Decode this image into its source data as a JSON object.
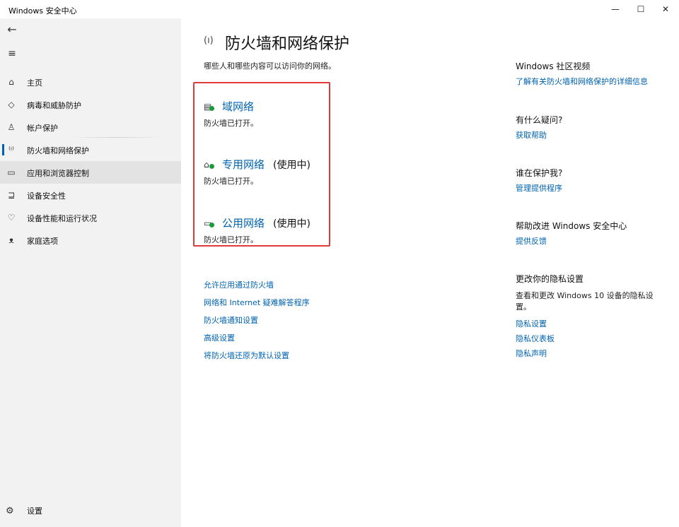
{
  "window": {
    "title": "Windows 安全中心",
    "minimize": "—",
    "maximize": "☐",
    "close": "✕"
  },
  "sidebar": {
    "back": "←",
    "menu": "≡",
    "items": [
      {
        "label": "主页",
        "icon": "home-icon"
      },
      {
        "label": "病毒和威胁防护",
        "icon": "shield-icon"
      },
      {
        "label": "帐户保护",
        "icon": "person-icon"
      },
      {
        "label": "防火墙和网络保护",
        "icon": "wifi-antenna-icon"
      },
      {
        "label": "应用和浏览器控制",
        "icon": "app-window-icon"
      },
      {
        "label": "设备安全性",
        "icon": "laptop-icon"
      },
      {
        "label": "设备性能和运行状况",
        "icon": "heart-icon"
      },
      {
        "label": "家庭选项",
        "icon": "family-icon"
      }
    ],
    "settings_label": "设置"
  },
  "main": {
    "header_icon": "(ı)",
    "title": "防火墙和网络保护",
    "subtitle": "哪些人和哪些内容可以访问你的网络。",
    "networks": [
      {
        "name": "域网络",
        "tag": "",
        "status": "防火墙已打开。"
      },
      {
        "name": "专用网络",
        "tag": "(使用中)",
        "status": "防火墙已打开。"
      },
      {
        "name": "公用网络",
        "tag": "(使用中)",
        "status": "防火墙已打开。"
      }
    ],
    "links": [
      "允许应用通过防火墙",
      "网络和 Internet 疑难解答程序",
      "防火墙通知设置",
      "高级设置",
      "将防火墙还原为默认设置"
    ]
  },
  "right": {
    "community_title": "Windows 社区视频",
    "community_link": "了解有关防火墙和网络保护的详细信息",
    "question_title": "有什么疑问?",
    "question_link": "获取帮助",
    "protect_title": "谁在保护我?",
    "protect_link": "管理提供程序",
    "improve_title": "帮助改进 Windows 安全中心",
    "improve_link": "提供反馈",
    "privacy_title": "更改你的隐私设置",
    "privacy_text": "查看和更改 Windows 10 设备的隐私设置。",
    "privacy_links": [
      "隐私设置",
      "隐私仪表板",
      "隐私声明"
    ]
  },
  "colors": {
    "accent": "#0063b1",
    "highlight_border": "#e03a3a",
    "status_green": "#1a9c3a",
    "sidebar_bg": "#f2f2f2"
  }
}
